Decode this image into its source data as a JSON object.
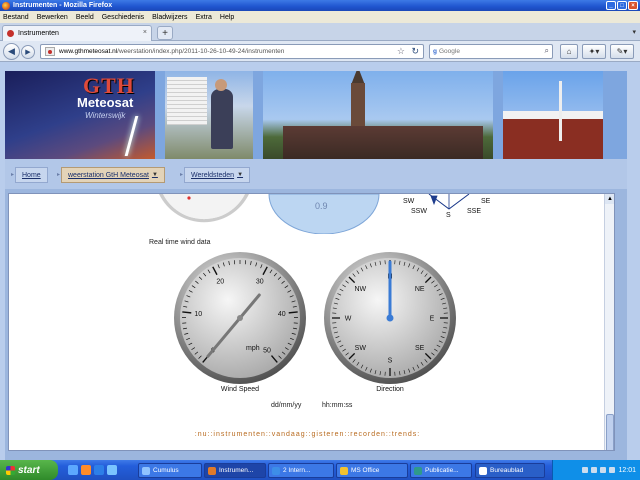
{
  "window": {
    "title": "Instrumenten - Mozilla Firefox",
    "controls": [
      "_",
      "□",
      "×"
    ]
  },
  "menubar": [
    "Bestand",
    "Bewerken",
    "Beeld",
    "Geschiedenis",
    "Bladwijzers",
    "Extra",
    "Help"
  ],
  "tabs": [
    {
      "label": "Instrumenten"
    }
  ],
  "nav": {
    "url_host": "www.gthmeteosat.nl",
    "url_path": "/weerstation/index.php/2011-10-26-10-49-24/instrumenten",
    "search_engine": "Google",
    "search_placeholder": "Google"
  },
  "banner": {
    "logo_line1": "GTH",
    "logo_line2": "Meteosat",
    "logo_line3": "Winterswijk"
  },
  "site_menu": [
    {
      "label": "Home",
      "has_dropdown": false
    },
    {
      "label": "weerstation GtH Meteosat",
      "has_dropdown": true
    },
    {
      "label": "Wereldsteden",
      "has_dropdown": true
    }
  ],
  "top_partial": {
    "rose_labels": [
      "SW",
      "SSW",
      "S",
      "SSE",
      "SE"
    ],
    "dial_value": "0.9"
  },
  "realtime_label": "Real time wind data",
  "wind_speed": {
    "caption": "Wind Speed",
    "unit": "mph",
    "ticks": [
      "0",
      "10",
      "20",
      "30",
      "40",
      "50"
    ],
    "value": 2,
    "max": 50
  },
  "direction": {
    "caption": "Direction",
    "labels": [
      "N",
      "NE",
      "E",
      "SE",
      "S",
      "SW",
      "W",
      "NW"
    ],
    "value_deg": 0
  },
  "time_labels": {
    "date": "dd/mm/yy",
    "time": "hh:mm:ss"
  },
  "bottom_nav": ":nu::instrumenten::vandaag::gisteren::recorden::trends:",
  "taskbar": {
    "start": "start",
    "items": [
      "Cumulus",
      "Instrumen...",
      "2 Intern...",
      "MS Office",
      "Publicatie...",
      "Bureaublad"
    ],
    "clock": "12:01"
  },
  "colors": {
    "titlebar": "#245edb",
    "link": "#1a2f6a",
    "bottom_nav": "#b86a1e",
    "needle": "#3a7bd5"
  }
}
